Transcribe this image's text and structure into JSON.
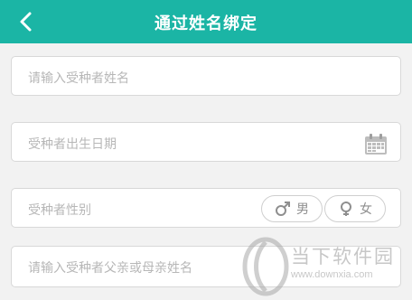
{
  "header": {
    "title": "通过姓名绑定",
    "back_icon": "back-arrow-icon",
    "background": "#1bb5a5"
  },
  "form": {
    "name_placeholder": "请输入受种者姓名",
    "birth_placeholder": "受种者出生日期",
    "birth_icon": "calendar-icon",
    "gender_label": "受种者性别",
    "gender_options": [
      "男",
      "女"
    ],
    "parent_placeholder": "请输入受种者父亲或母亲姓名"
  },
  "watermark": {
    "name": "当下软件园",
    "url": "www.downxia.com"
  }
}
